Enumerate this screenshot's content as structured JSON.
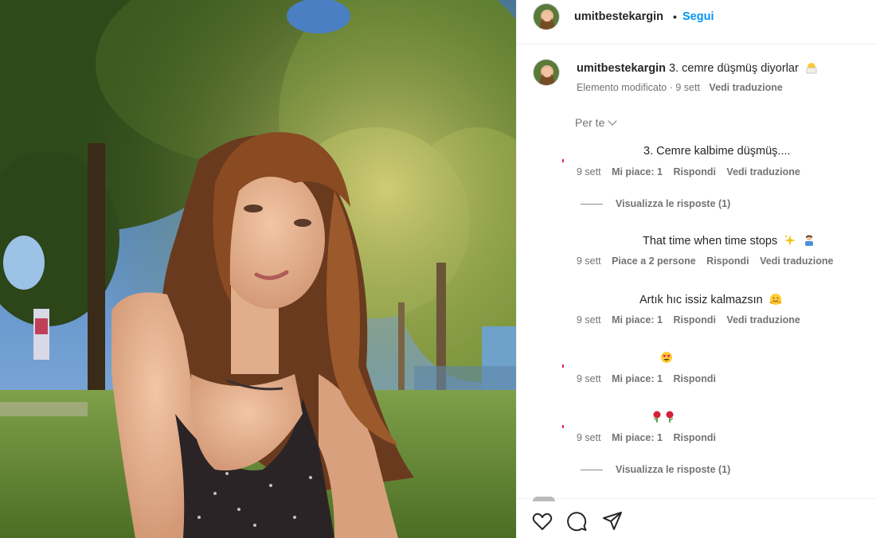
{
  "header": {
    "username": "umitbestekargin",
    "dot": "•",
    "follow_label": "Segui"
  },
  "caption": {
    "username": "umitbestekargin",
    "text": "3. cemre düşmüş diyorlar",
    "edited": "Elemento modificato · 9 sett",
    "translate": "Vedi traduzione",
    "emoji_icon": "hatching-chick-icon"
  },
  "sort": {
    "label": "Per te"
  },
  "comments": [
    {
      "text": "3. Cemre kalbime düşmüş....",
      "time": "9 sett",
      "likes": "Mi piace: 1",
      "reply": "Rispondi",
      "translate": "Vedi traduzione",
      "replies": "Visualizza le risposte (1)"
    },
    {
      "text": "That time when time stops",
      "time": "9 sett",
      "likes": "Piace a 2 persone",
      "reply": "Rispondi",
      "translate": "Vedi traduzione",
      "emoji_icons": [
        "sparkles-icon",
        "person-tipping-hand-icon"
      ]
    },
    {
      "text": "Artık hıc issiz kalmazsın",
      "time": "9 sett",
      "likes": "Mi piace: 1",
      "reply": "Rispondi",
      "translate": "Vedi traduzione",
      "emoji_icons": [
        "hugging-face-icon"
      ]
    },
    {
      "text": "",
      "time": "9 sett",
      "likes": "Mi piace: 1",
      "reply": "Rispondi",
      "emoji_icons": [
        "heart-eyes-icon"
      ]
    },
    {
      "text": "",
      "time": "9 sett",
      "likes": "Mi piace: 1",
      "reply": "Rispondi",
      "replies": "Visualizza le risposte (1)",
      "emoji_icons": [
        "rose-icon",
        "rose-icon"
      ]
    }
  ],
  "actions": {
    "icons": [
      "heart-icon",
      "comment-icon",
      "share-icon"
    ]
  },
  "colors": {
    "link": "#0095f6",
    "muted": "#737373",
    "text": "#262626"
  }
}
